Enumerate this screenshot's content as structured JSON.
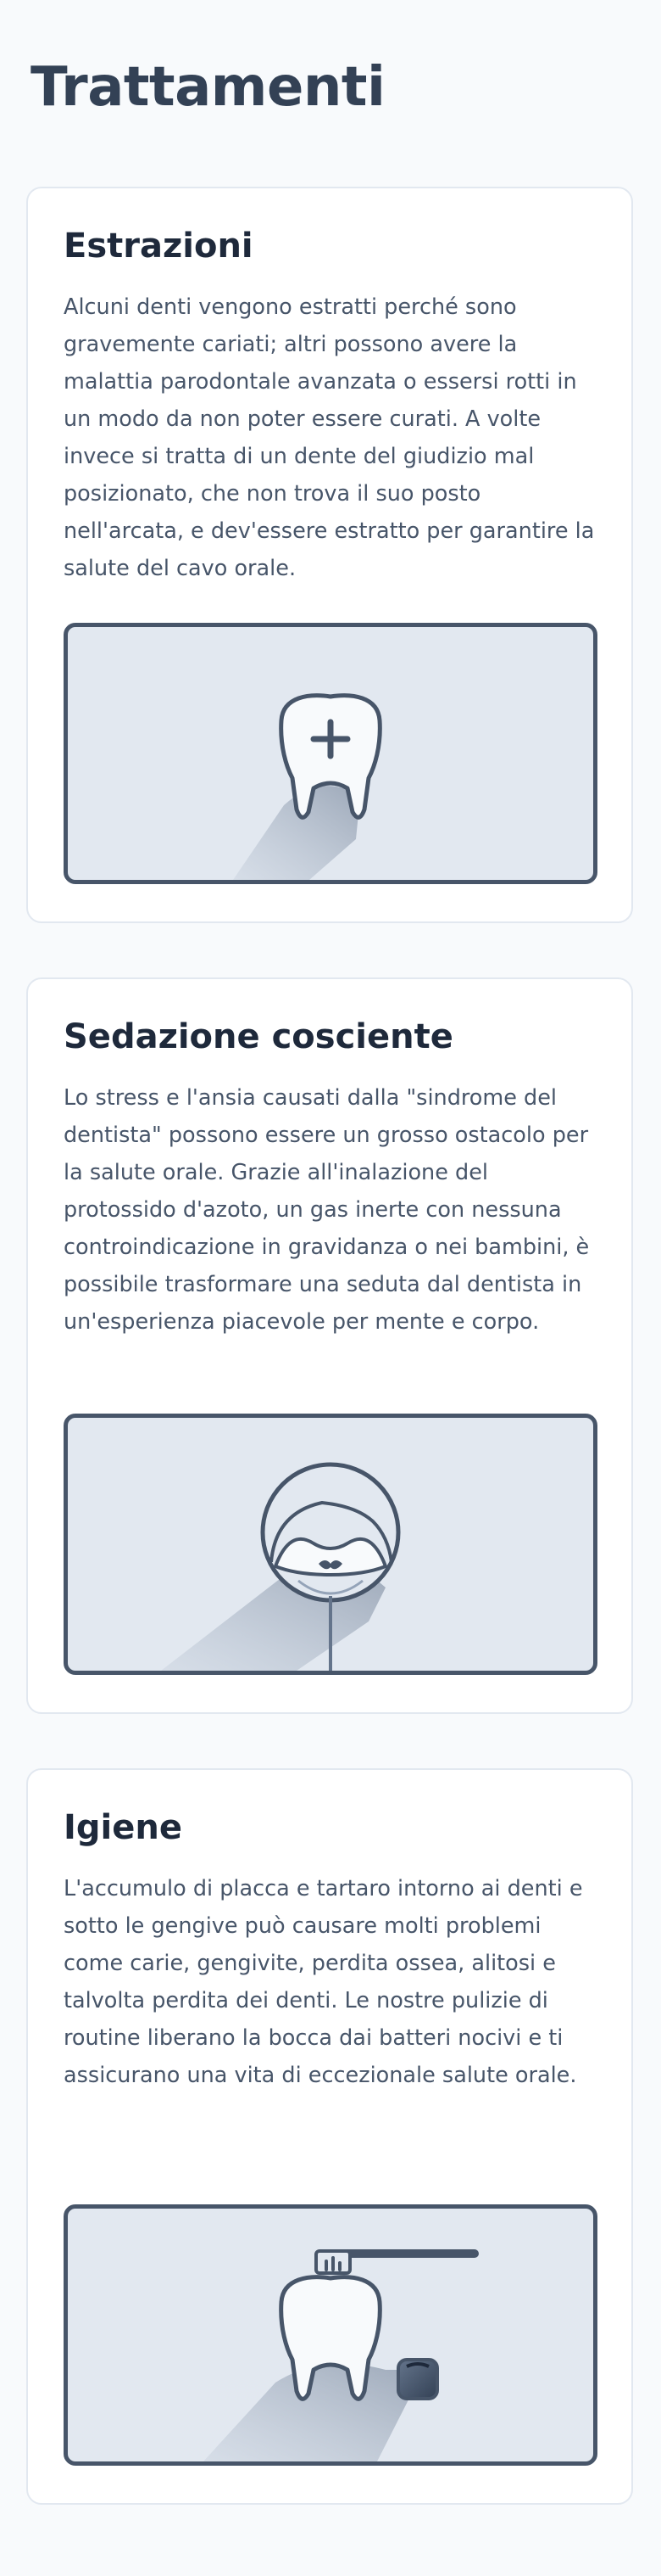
{
  "page": {
    "title": "Trattamenti"
  },
  "treatments": [
    {
      "title": "Estrazioni",
      "description": "Alcuni denti vengono estratti perché sono gravemente cariati; altri possono avere la malattia parodontale avanzata o essersi rotti in un modo da non poter essere curati. A volte invece si tratta di un dente del giudizio mal posizionato, che non trova il suo posto nell'arcata, e dev'essere estratto per garantire la salute del cavo orale.",
      "illustration_icon": "tooth-plus-icon"
    },
    {
      "title": "Sedazione cosciente",
      "description": "Lo stress e l'ansia causati dalla \"sindrome del dentista\" possono essere un grosso ostacolo per la salute orale. Grazie all'inalazione del protossido d'azoto, un gas inerte con nessuna controindicazione in gravidanza o nei bambini, è possibile trasformare una seduta dal dentista in un'esperienza piacevole per mente e corpo.",
      "illustration_icon": "relaxed-face-icon"
    },
    {
      "title": "Igiene",
      "description": "L'accumulo di placca e tartaro intorno ai denti e sotto le gengive può causare molti problemi come carie, gengivite, perdita ossea, alitosi e talvolta perdita dei denti. Le nostre pulizie di routine liberano la bocca dai batteri nocivi e ti assicurano una vita di eccezionale salute orale.",
      "illustration_icon": "tooth-toothbrush-icon"
    }
  ],
  "colors": {
    "background": "#f8fafc",
    "card": "#ffffff",
    "card_border": "#e2e8f0",
    "heading": "#1e293b",
    "text": "#475569",
    "illustration_bg": "#e2e8f0",
    "illustration_stroke": "#475569"
  }
}
